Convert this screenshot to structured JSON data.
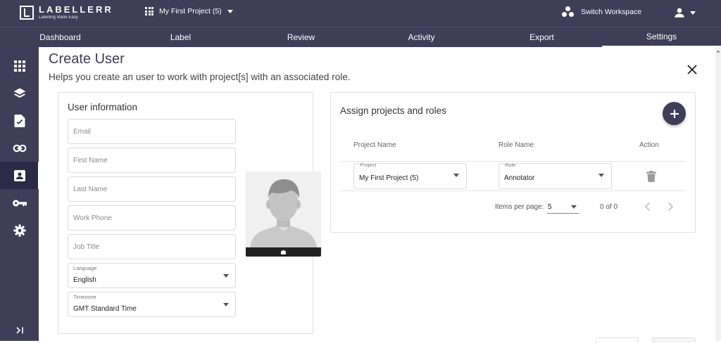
{
  "brand": {
    "name": "LABELLERR",
    "tagline": "Labelling Made Easy"
  },
  "header": {
    "project_selector": "My First Project (5)",
    "switch_workspace": "Switch Workspace"
  },
  "nav": {
    "tabs": [
      {
        "label": "Dashboard"
      },
      {
        "label": "Label"
      },
      {
        "label": "Review"
      },
      {
        "label": "Activity"
      },
      {
        "label": "Export"
      },
      {
        "label": "Settings",
        "active": true
      }
    ]
  },
  "sidebar": {
    "items": [
      {
        "icon": "apps-grid-icon"
      },
      {
        "icon": "layers-icon"
      },
      {
        "icon": "document-check-icon"
      },
      {
        "icon": "link-icon"
      },
      {
        "icon": "contact-card-icon",
        "active": true
      },
      {
        "icon": "key-icon"
      },
      {
        "icon": "gear-icon"
      }
    ],
    "collapse_label": "›|"
  },
  "page": {
    "title": "Create User",
    "subtitle": "Helps you create an user to work with project[s] with an associated role."
  },
  "user_info": {
    "title": "User information",
    "email_placeholder": "Email",
    "first_name_placeholder": "First Name",
    "last_name_placeholder": "Last Name",
    "work_phone_placeholder": "Work Phone",
    "job_title_placeholder": "Job Title",
    "language_label": "Language",
    "language_value": "English",
    "timezone_label": "Timezone",
    "timezone_value": "GMT Standard Time"
  },
  "assign": {
    "title": "Assign projects and roles",
    "columns": [
      "Project Name",
      "Role Name",
      "Action"
    ],
    "rows": [
      {
        "project_label": "Project",
        "project_value": "My First Project (5)",
        "role_label": "Role",
        "role_value": "Annotator"
      }
    ],
    "items_per_page_label": "Items per page:",
    "page_size": "5",
    "range": "0 of 0"
  },
  "colors": {
    "primary": "#3f3d57",
    "rail_active": "#2c2a44"
  }
}
